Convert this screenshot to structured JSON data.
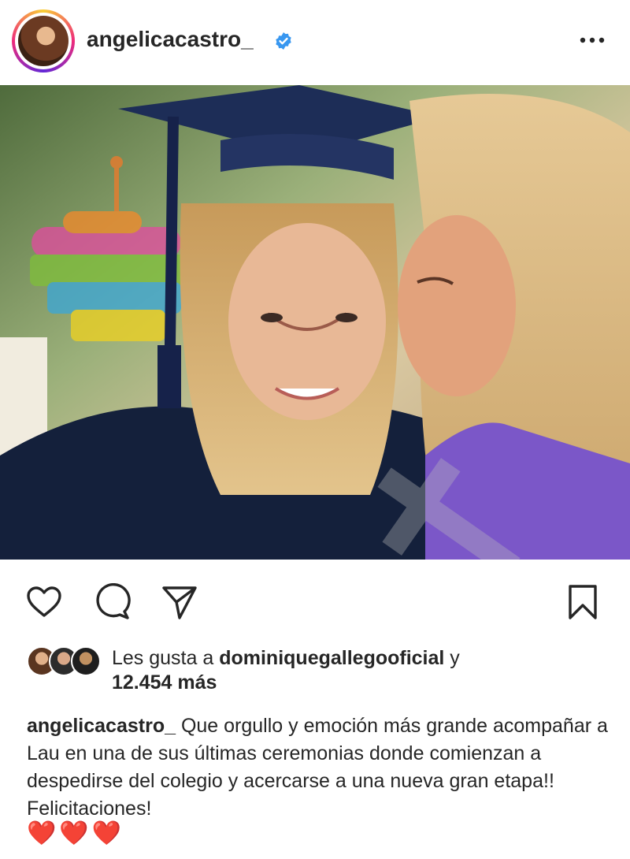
{
  "post": {
    "username": "angelicacastro_",
    "verified": true,
    "more_icon": "more-dots-icon"
  },
  "actions": {
    "like_icon": "heart-icon",
    "comment_icon": "comment-icon",
    "share_icon": "send-icon",
    "save_icon": "bookmark-icon"
  },
  "likes": {
    "prefix": "Les gusta a ",
    "user": "dominiquegallegooficial",
    "conj": " y",
    "count": "12.454 más"
  },
  "caption": {
    "username": "angelicacastro_",
    "text": " Que orgullo y emoción más grande acompañar a Lau en una de sus últimas ceremonias donde comienzan a despedirse del colegio y acercarse a una nueva gran etapa!! Felicitaciones!",
    "emoji": "❤️❤️❤️"
  },
  "colors": {
    "verified_blue": "#3897f0",
    "text": "#262626",
    "heart_red": "#e0243b"
  }
}
